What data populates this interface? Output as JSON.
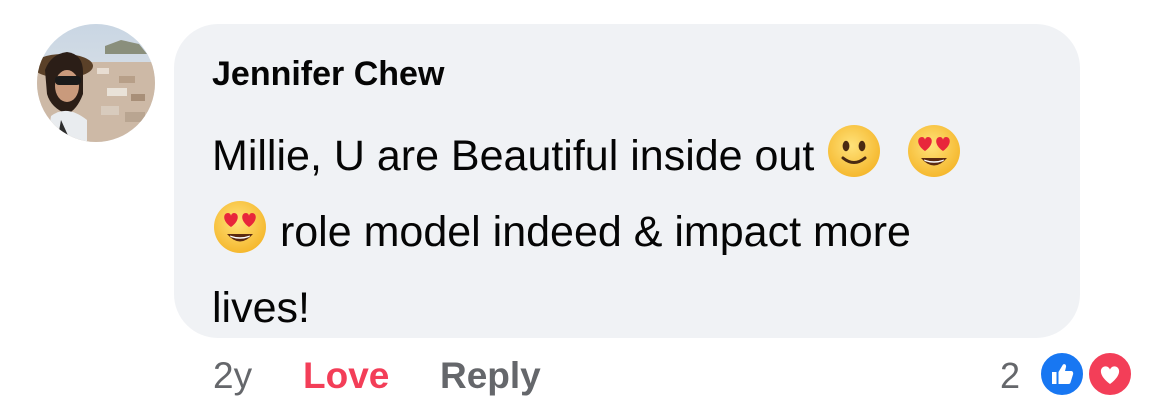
{
  "comment": {
    "author": "Jennifer Chew",
    "text_line1": "Millie, U are Beautiful inside out",
    "text_line2": "role model indeed & impact more",
    "text_line3": "lives!",
    "emojis": [
      "slightly-smiling-face-emoji",
      "heart-eyes-emoji",
      "heart-eyes-emoji"
    ]
  },
  "actions": {
    "timestamp": "2y",
    "love_label": "Love",
    "reply_label": "Reply"
  },
  "reactions": {
    "count": "2",
    "types": [
      "like-icon",
      "heart-icon"
    ]
  },
  "colors": {
    "bubble_bg": "#f0f2f5",
    "love_accent": "#f33e58",
    "like_blue": "#1877f2",
    "secondary_text": "#65676b"
  }
}
